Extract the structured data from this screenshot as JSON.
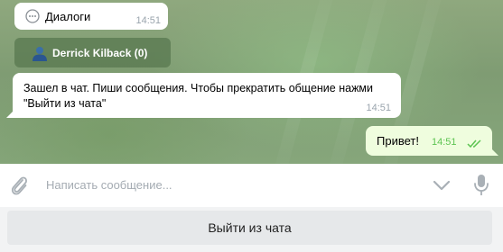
{
  "messages": {
    "dialogs": {
      "label": "Диалоги",
      "time": "14:51",
      "icon": "speech-bubble-icon"
    },
    "inline_button": {
      "label": "Derrick Kilback (0)",
      "icon": "user-silhouette-icon"
    },
    "info": {
      "text": "Зашел в чат. Пиши сообщения. Чтобы прекратить общение нажми \"Выйти из чата\"",
      "time": "14:51"
    },
    "outgoing": {
      "text": "Привет!",
      "time": "14:51",
      "status_icon": "double-check-icon"
    }
  },
  "composer": {
    "placeholder": "Написать сообщение...",
    "value": "",
    "attach_icon": "paperclip-icon",
    "keyboard_toggle_icon": "chevron-down-icon",
    "mic_icon": "microphone-icon"
  },
  "reply_keyboard": {
    "button_label": "Выйти из чата"
  },
  "colors": {
    "outgoing_bubble": "#effdde",
    "read_checks": "#5dc452",
    "inline_button_bg": "#56764e",
    "chat_background": "#8fa87e"
  }
}
